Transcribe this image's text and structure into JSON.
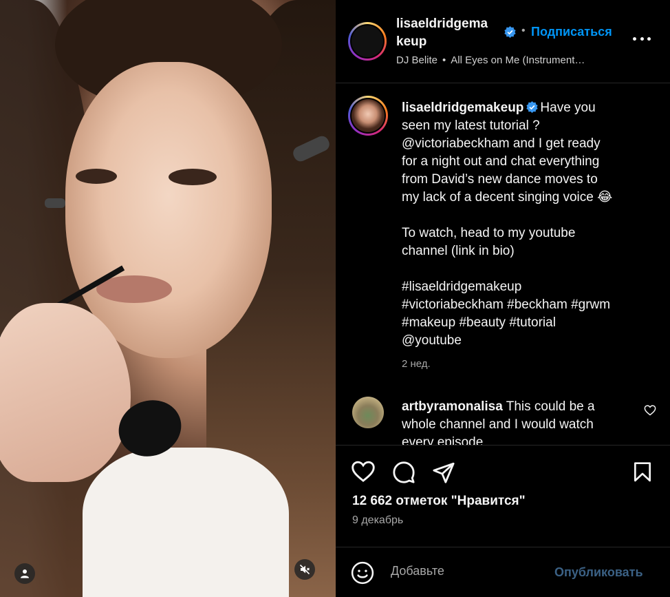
{
  "header": {
    "username_line1": "lisaeldridgema",
    "username_line2": "keup",
    "dot": "•",
    "follow_label": "Подписаться",
    "audio_artist": "DJ Belite",
    "audio_sep": "•",
    "audio_track": "All Eyes on Me (Instrument…"
  },
  "caption": {
    "username": "lisaeldridgemakeup",
    "lines": [
      "Have you",
      "seen my latest tutorial ?",
      "@victoriabeckham and I get ready",
      "for a night out and chat everything",
      "from David’s new dance moves to",
      "my lack of a decent singing voice 😂",
      "",
      "To watch, head to my youtube",
      "channel (link in bio)",
      "",
      "#lisaeldridgemakeup",
      "#victoriabeckham #beckham #grwm",
      "#makeup #beauty #tutorial",
      "@youtube"
    ],
    "time": "2 нед."
  },
  "comment": {
    "username": "artbyramonalisa",
    "text_line1": "This could be a",
    "text_line2": "whole channel and I would watch",
    "text_line3": "every episode"
  },
  "actions": {
    "likes": "12 662 отметок \"Нравится\"",
    "date": "9 декабрь"
  },
  "add_comment": {
    "placeholder": "Добавьте",
    "publish_label": "Опубликовать"
  },
  "colors": {
    "background": "#000000",
    "text": "#f5f5f5",
    "secondary_text": "#a8a8a8",
    "link_blue": "#0095f6",
    "publish_disabled": "#3b6185",
    "divider": "#262626"
  },
  "icons": {
    "verified": "verified-badge-icon",
    "more": "more-options-icon",
    "like": "heart-icon",
    "comment": "comment-bubble-icon",
    "share": "paper-plane-icon",
    "save": "bookmark-icon",
    "emoji": "emoji-smile-icon",
    "user_tag": "user-icon",
    "mute": "speaker-muted-icon"
  }
}
